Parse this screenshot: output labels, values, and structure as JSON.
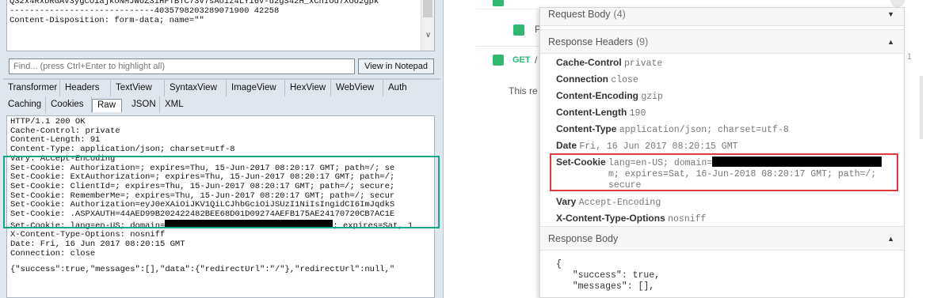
{
  "left": {
    "request_body": {
      "lines": [
        "Q32x4RxURGAV3ygcOiajkoNMJWUZ3iHFTBTC73v7sAoiz4LYi6v-u2gS42H_xCnIOd7XOU2gpk",
        "-----------------------------4035798203289071900 42258",
        "Content-Disposition: form-data; name=\"\""
      ]
    },
    "find": {
      "placeholder": "Find... (press Ctrl+Enter to highlight all)",
      "view_notepad_label": "View in Notepad"
    },
    "tabs_row1": [
      "Transformer",
      "Headers",
      "TextView",
      "SyntaxView",
      "ImageView",
      "HexView",
      "WebView",
      "Auth"
    ],
    "tabs_row2": [
      "Caching",
      "Cookies",
      "Raw",
      "JSON",
      "XML"
    ],
    "tabs_row2_selected": "Raw",
    "response_raw": {
      "lines": [
        "HTTP/1.1 200 OK",
        "Cache-Control: private",
        "Content-Length: 91",
        "Content-Type: application/json; charset=utf-8",
        "Vary: Accept-Encoding",
        "Set-Cookie: Authorization=; expires=Thu, 15-Jun-2017 08:20:17 GMT; path=/; se",
        "Set-Cookie: ExtAuthorization=; expires=Thu, 15-Jun-2017 08:20:17 GMT; path=/;",
        "Set-Cookie: ClientId=; expires=Thu, 15-Jun-2017 08:20:17 GMT; path=/; secure;",
        "Set-Cookie: RememberMe=; expires=Thu, 15-Jun-2017 08:20:17 GMT; path=/; secur",
        "Set-Cookie: Authorization=eyJ0eXAiOiJKV1QiLCJhbGciOiJSUzI1NiIsIngidCI6ImJqdkS",
        "Set-Cookie: .ASPXAUTH=44AED99B202422482BEE68D01D09274AEFB175AE24170720CB7AC1E",
        "Set-Cookie: lang=en-US; domain=",
        "X-Content-Type-Options: nosniff",
        "Date: Fri, 16 Jun 2017 08:20:15 GMT",
        "Connection: close"
      ],
      "lang_line_suffix": "; expires=Sat, 1",
      "body_line": "{\"success\":true,\"messages\":[],\"data\":{\"redirectUrl\":\"/\"},\"redirectUrl\":null,\""
    }
  },
  "background": {
    "row2_label": "P",
    "row3_method": "GET",
    "row3_path": "/",
    "text": "This re",
    "scroll_marker": "1"
  },
  "details": {
    "request_body": {
      "title": "Request Body",
      "count": "(4)"
    },
    "response_headers": {
      "title": "Response Headers",
      "count": "(9)"
    },
    "headers": [
      {
        "key": "Cache-Control",
        "value": "private"
      },
      {
        "key": "Connection",
        "value": "close"
      },
      {
        "key": "Content-Encoding",
        "value": "gzip"
      },
      {
        "key": "Content-Length",
        "value": "190"
      },
      {
        "key": "Content-Type",
        "value": "application/json; charset=utf-8"
      },
      {
        "key": "Date",
        "value": "Fri, 16 Jun 2017 08:20:15 GMT"
      },
      {
        "key": "Set-Cookie",
        "value_line1": "lang=en-US; domain=",
        "value_line2": "m; expires=Sat, 16-Jun-2018 08:20:17 GMT; path=/;",
        "value_line3": "secure"
      },
      {
        "key": "Vary",
        "value": "Accept-Encoding"
      },
      {
        "key": "X-Content-Type-Options",
        "value": "nosniff"
      }
    ],
    "response_body": {
      "title": "Response Body",
      "lines": [
        "{",
        "   \"success\": true,",
        "   \"messages\": [],"
      ]
    }
  },
  "colors": {
    "highlight_green": "#17a589",
    "highlight_red": "#e0393c",
    "status_green": "#2eb872"
  }
}
